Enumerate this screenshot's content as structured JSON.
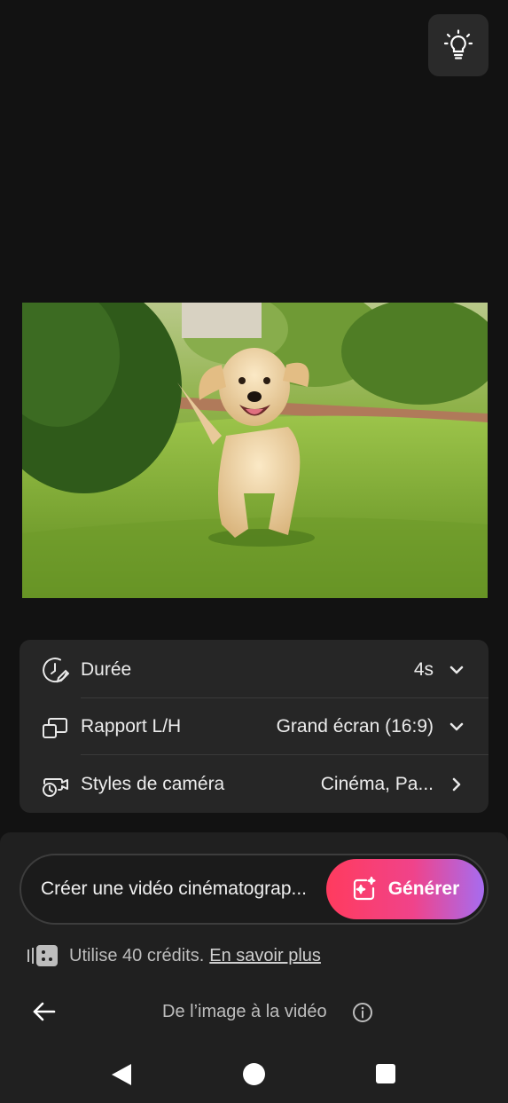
{
  "top": {
    "idea_icon": "lightbulb-icon"
  },
  "photo": {
    "subject": ""
  },
  "settings": {
    "rows": [
      {
        "icon": "clock-edit-icon",
        "label": "Durée",
        "value": "4s",
        "control": "chevron-down-icon"
      },
      {
        "icon": "aspect-ratio-icon",
        "label": "Rapport L/H",
        "value": "Grand écran (16:9)",
        "control": "chevron-down-icon"
      },
      {
        "icon": "camera-style-icon",
        "label": "Styles de caméra",
        "value": "Cinéma, Pa...",
        "control": "chevron-right-icon"
      }
    ]
  },
  "prompt": {
    "text": "Créer une vidéo cinématograp...",
    "generate_label": "Générer",
    "generate_icon": "sparkle-image-icon",
    "generate_gradient": [
      "#ff3b5e",
      "#f0438a",
      "#a66cf0"
    ]
  },
  "credits": {
    "icon": "credits-icon",
    "text": "Utilise 40 crédits.",
    "link": "En savoir plus"
  },
  "nav": {
    "back_icon": "arrow-left-icon",
    "title": "De l’image à la vidéo",
    "info_icon": "info-icon"
  },
  "system_nav": [
    "back-triangle-icon",
    "home-circle-icon",
    "recents-square-icon"
  ]
}
